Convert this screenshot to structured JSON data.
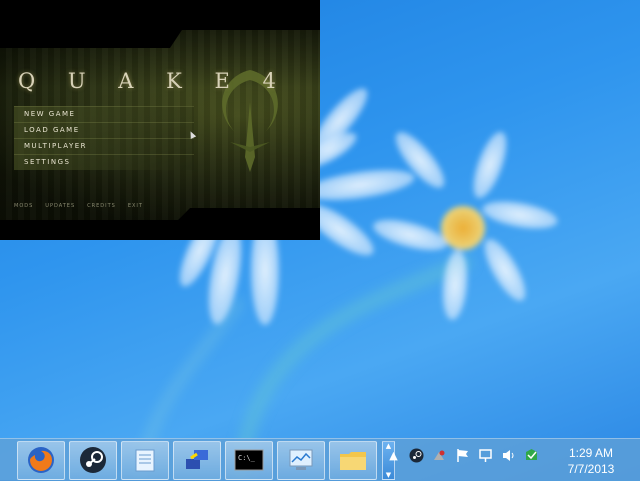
{
  "game": {
    "title": "Q U A K E 4",
    "menu": [
      "NEW GAME",
      "LOAD GAME",
      "MULTIPLAYER",
      "SETTINGS"
    ],
    "footer": [
      "MODS",
      "UPDATES",
      "CREDITS",
      "EXIT"
    ]
  },
  "taskbar": {
    "apps": [
      "firefox-icon",
      "steam-icon",
      "notepad-icon",
      "network-setup-icon",
      "command-prompt-icon",
      "resource-monitor-icon",
      "file-explorer-icon"
    ],
    "tray_icons": [
      "show-hidden-icons-chevron",
      "steam-tray-icon",
      "unknown-tray-icon",
      "action-center-flag-icon",
      "network-icon",
      "volume-icon",
      "security-icon"
    ]
  },
  "clock": {
    "time": "1:29 AM",
    "date": "7/7/2013"
  },
  "colors": {
    "accent": "#2f95ee",
    "menu_text": "#e8e4d0"
  }
}
